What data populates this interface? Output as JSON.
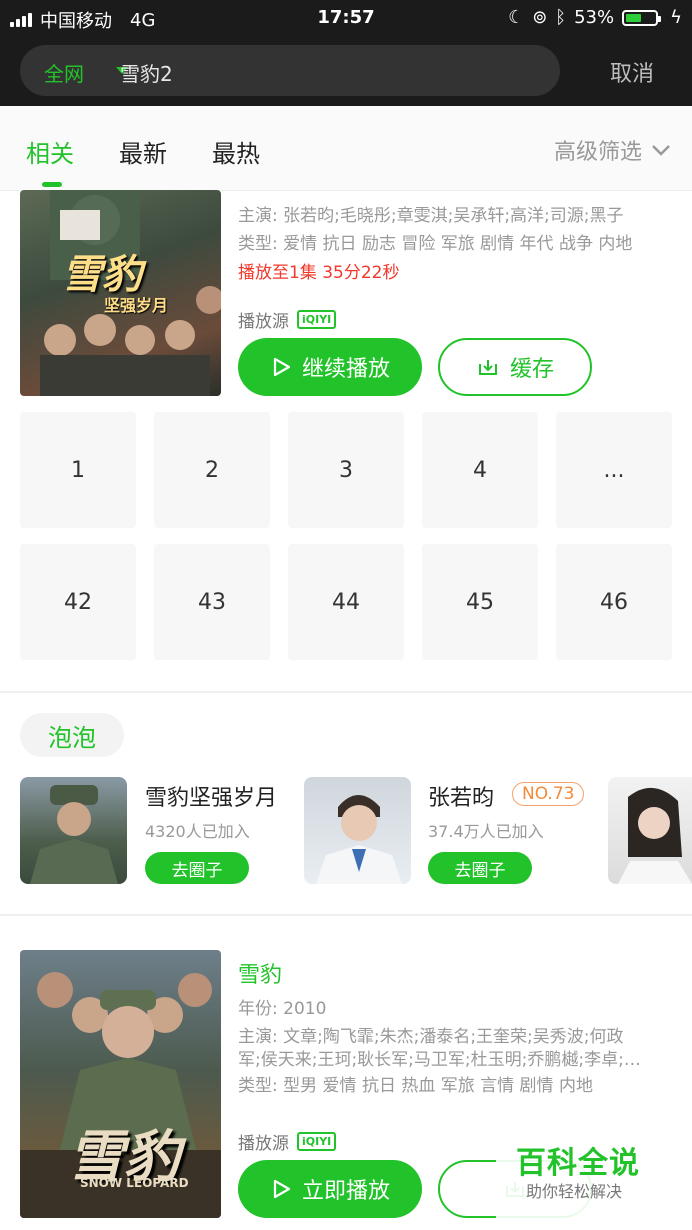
{
  "status": {
    "carrier": "中国移动",
    "network": "4G",
    "time": "17:57",
    "battery_percent": "53%",
    "battery_level": 0.53
  },
  "search": {
    "scope": "全网",
    "query": "雪豹2",
    "cancel": "取消"
  },
  "tabs": {
    "items": [
      "相关",
      "最新",
      "最热"
    ],
    "active": "相关",
    "filter": "高级筛选"
  },
  "show1": {
    "cast": "主演: 张若昀;毛晓彤;章雯淇;吴承轩;高洋;司源;黑子",
    "genre": "类型: 爱情 抗日 励志 冒险 军旅 剧情 年代 战争 内地",
    "progress": "播放至1集 35分22秒",
    "source_label": "播放源",
    "source_badge": "iQIYI",
    "play_btn": "继续播放",
    "cache_btn": "缓存",
    "poster_title": "雪豹",
    "poster_subtitle": "坚强岁月",
    "episodes_row1": [
      "1",
      "2",
      "3",
      "4",
      "..."
    ],
    "episodes_row2": [
      "42",
      "43",
      "44",
      "45",
      "46"
    ]
  },
  "bubbles": {
    "section_title": "泡泡",
    "items": [
      {
        "title": "雪豹坚强岁月",
        "count": "4320人已加入",
        "button": "去圈子"
      },
      {
        "title": "张若昀",
        "rank": "NO.73",
        "count": "37.4万人已加入",
        "button": "去圈子"
      }
    ]
  },
  "show2": {
    "title": "雪豹",
    "year": "年份: 2010",
    "cast_line1": "主演: 文章;陶飞霏;朱杰;潘泰名;王奎荣;吴秀波;何政",
    "cast_line2": "军;侯天来;王珂;耿长军;马卫军;杜玉明;乔鹏樾;李卓;…",
    "genre": "类型: 型男 爱情 抗日 热血 军旅 言情 剧情 内地",
    "source_label": "播放源",
    "source_badge": "iQIYI",
    "play_btn": "立即播放",
    "poster_title": "雪豹",
    "poster_subtitle": "SNOW LEOPARD"
  },
  "watermark": {
    "title": "百科全说",
    "subtitle": "助你轻松解决"
  },
  "colors": {
    "accent": "#22c32a",
    "progress_red": "#f2372b",
    "rank_orange": "#f28a3a"
  }
}
